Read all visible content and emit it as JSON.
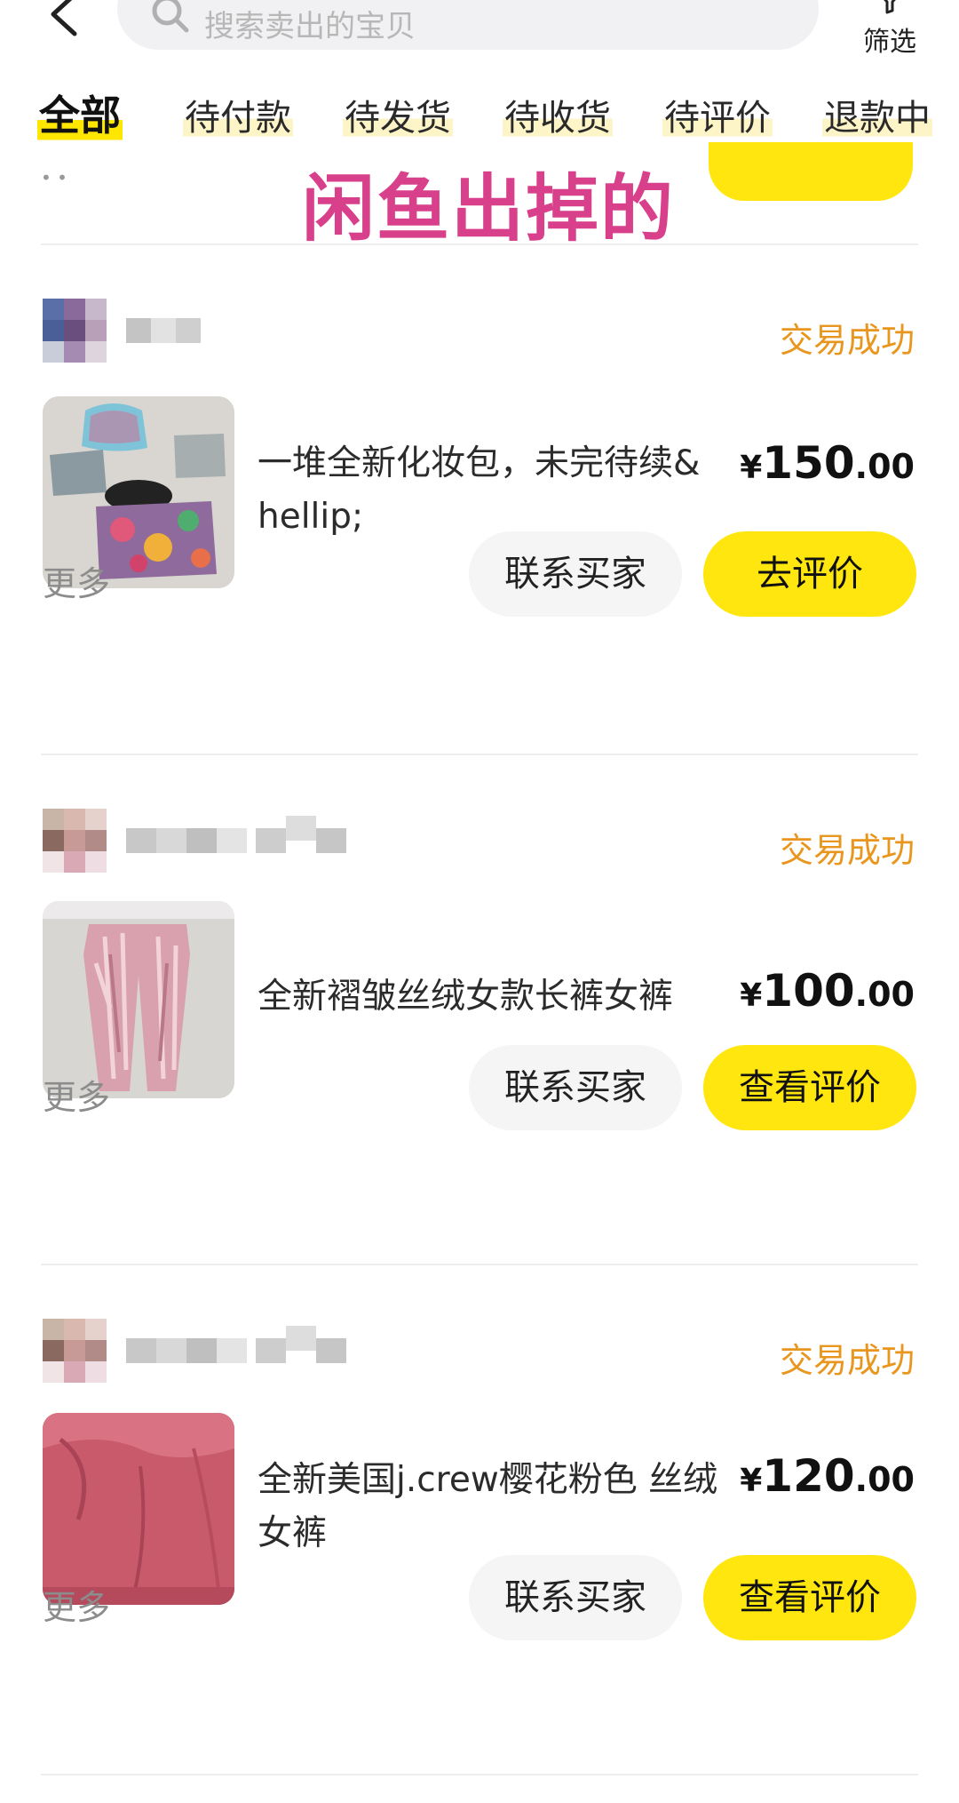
{
  "topbar": {
    "search_placeholder": "搜索卖出的宝贝",
    "filter_label": "筛选"
  },
  "tabs": [
    {
      "label": "全部",
      "active": true
    },
    {
      "label": "待付款"
    },
    {
      "label": "待发货"
    },
    {
      "label": "待收货"
    },
    {
      "label": "待评价"
    },
    {
      "label": "退款中"
    }
  ],
  "overlay_title": "闲鱼出掉的",
  "orders": [
    {
      "status": "交易成功",
      "title": "一堆全新化妆包，未完待续&hellip;",
      "price_currency": "¥",
      "price_int": "150",
      "price_dec": ".00",
      "more": "更多",
      "contact_label": "联系买家",
      "action_label": "去评价"
    },
    {
      "status": "交易成功",
      "title": "全新褶皱丝绒女款长裤女裤",
      "price_currency": "¥",
      "price_int": "100",
      "price_dec": ".00",
      "more": "更多",
      "contact_label": "联系买家",
      "action_label": "查看评价"
    },
    {
      "status": "交易成功",
      "title": "全新美国j.crew樱花粉色 丝绒女裤",
      "price_currency": "¥",
      "price_int": "120",
      "price_dec": ".00",
      "more": "更多",
      "contact_label": "联系买家",
      "action_label": "查看评价"
    }
  ],
  "colors": {
    "accent_yellow": "#ffe60f",
    "status_orange": "#e8961e",
    "overlay_pink": "#d8408b"
  },
  "icons": [
    "back-icon",
    "search-icon",
    "filter-icon"
  ]
}
